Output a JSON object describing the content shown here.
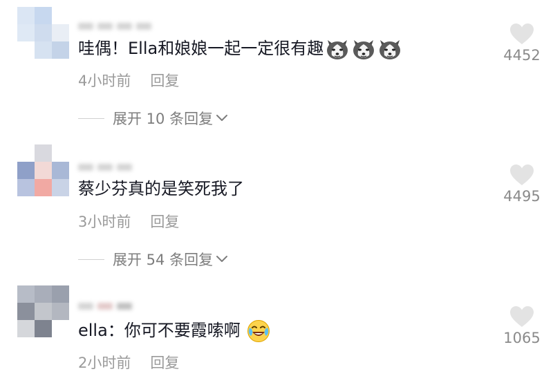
{
  "comments": [
    {
      "text": "哇偶！Ella和娘娘一起一定很有趣",
      "emoji": "husky-dog-emoji",
      "emoji_count": 3,
      "time": "4小时前",
      "reply_label": "回复",
      "expand_label": "展开 10 条回复",
      "likes": "4452"
    },
    {
      "text": "蔡少芬真的是笑死我了",
      "time": "3小时前",
      "reply_label": "回复",
      "expand_label": "展开 54 条回复",
      "likes": "4495"
    },
    {
      "text": "ella：你可不要霞嗦啊",
      "emoji": "crying-laughing-emoji",
      "time": "2小时前",
      "reply_label": "回复",
      "likes": "1065"
    }
  ],
  "icons": {
    "like": "heart-icon",
    "expand": "chevron-down-icon"
  },
  "colors": {
    "text": "#161823",
    "meta": "#9a9a9a",
    "heart": "#e3e3e3",
    "count": "#8a8a8a"
  }
}
